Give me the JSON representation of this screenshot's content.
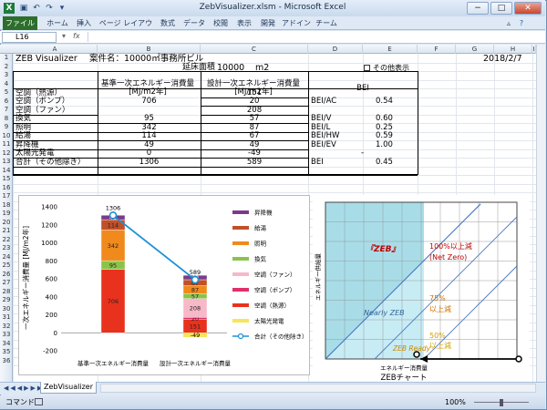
{
  "window": {
    "title": "ZebVisualizer.xlsm - Microsoft Excel",
    "controls": [
      "−",
      "□",
      "✕"
    ]
  },
  "ribbon": {
    "tabs": [
      "ファイル",
      "ホーム",
      "挿入",
      "ページ レイアウト",
      "数式",
      "データ",
      "校閲",
      "表示",
      "開発",
      "アドイン",
      "チーム"
    ]
  },
  "formula_bar": {
    "name_box": "L16",
    "fx": "fx",
    "content": ""
  },
  "columns": [
    "A",
    "B",
    "C",
    "D",
    "E",
    "F",
    "G",
    "H",
    "I"
  ],
  "rows": [
    "1",
    "2",
    "3",
    "4",
    "5",
    "6",
    "7",
    "8",
    "9",
    "10",
    "11",
    "12",
    "13",
    "14",
    "15",
    "16",
    "17",
    "18",
    "19",
    "20",
    "21",
    "22",
    "23",
    "24",
    "25",
    "26",
    "27",
    "28",
    "29",
    "30",
    "31",
    "32",
    "33",
    "34",
    "35",
    "36"
  ],
  "sheet": {
    "app_name": "ZEB Visualizer",
    "project": "案件名：10000㎡事務所ビル",
    "date": "2018/2/7",
    "floor_area_label": "延床面積",
    "floor_area_value": "10000",
    "floor_area_unit": "m2",
    "checkbox_label": "その他表示",
    "hdr_base": "基準一次エネルギー消費量",
    "hdr_base_unit": "[MJ/m2年]",
    "hdr_design": "設計一次エネルギー消費量",
    "hdr_design_unit": "[MJ/m2年]",
    "hdr_bei": "BEI",
    "rows": [
      {
        "label": "空調（熱源）",
        "base": "",
        "design": "151",
        "bei_label": "",
        "bei_value": ""
      },
      {
        "label": "空調（ポンプ）",
        "base": "706",
        "design": "20",
        "bei_label": "BEI/AC",
        "bei_value": "0.54"
      },
      {
        "label": "空調（ファン）",
        "base": "",
        "design": "208",
        "bei_label": "",
        "bei_value": ""
      },
      {
        "label": "換気",
        "base": "95",
        "design": "57",
        "bei_label": "BEI/V",
        "bei_value": "0.60"
      },
      {
        "label": "照明",
        "base": "342",
        "design": "87",
        "bei_label": "BEI/L",
        "bei_value": "0.25"
      },
      {
        "label": "給湯",
        "base": "114",
        "design": "67",
        "bei_label": "BEI/HW",
        "bei_value": "0.59"
      },
      {
        "label": "昇降機",
        "base": "49",
        "design": "49",
        "bei_label": "BEI/EV",
        "bei_value": "1.00"
      },
      {
        "label": "太陽光発電",
        "base": "0",
        "design": "-49",
        "bei_label": "",
        "bei_value": "-"
      },
      {
        "label": "合計（その他除き）",
        "base": "1306",
        "design": "589",
        "bei_label": "BEI",
        "bei_value": "0.45"
      }
    ]
  },
  "chart_data": [
    {
      "type": "bar",
      "categories": [
        "基準一次エネルギー消費量",
        "設計一次エネルギー消費量"
      ],
      "ylabel": "一次エネルギー消費量 [MJ/m2年]",
      "ylim": [
        -200,
        1400
      ],
      "yticks": [
        "1400",
        "1200",
        "1000",
        "800",
        "600",
        "400",
        "200",
        "0",
        "-200"
      ],
      "series": [
        {
          "name": "昇降機",
          "color": "#7a3b8c",
          "values": [
            49,
            49
          ]
        },
        {
          "name": "給湯",
          "color": "#c0502a",
          "values": [
            114,
            67
          ]
        },
        {
          "name": "照明",
          "color": "#f08a1c",
          "values": [
            342,
            87
          ]
        },
        {
          "name": "換気",
          "color": "#8bc34a",
          "values": [
            95,
            57
          ]
        },
        {
          "name": "空調（ファン）",
          "color": "#f7b8c8",
          "values": [
            0,
            208
          ]
        },
        {
          "name": "空調（ポンプ）",
          "color": "#e0306a",
          "values": [
            0,
            20
          ]
        },
        {
          "name": "空調（熱源）",
          "color": "#e8321e",
          "values": [
            706,
            151
          ]
        },
        {
          "name": "太陽光発電",
          "color": "#f5e65a",
          "values": [
            0,
            -49
          ]
        }
      ],
      "bar_labels": [
        [
          "49",
          "114",
          "342",
          "95",
          "",
          "",
          "706",
          ""
        ],
        [
          "49",
          "67",
          "87",
          "57",
          "208",
          "20",
          "151",
          "-49"
        ]
      ],
      "line": {
        "name": "合計（その他除き）",
        "color": "#1e90d6",
        "values": [
          1306,
          589
        ]
      },
      "total_labels": [
        "1306",
        "589"
      ],
      "legend_position": "right"
    },
    {
      "type": "diagram",
      "title": "ZEBチャート",
      "xlabel": "エネルギー消費量",
      "ylabel": "エネルギー供給量",
      "regions": [
        "『ZEB』",
        "Nearly ZEB",
        "ZEB Ready"
      ],
      "reduction_labels": [
        "100%以上減",
        "(Net Zero)",
        "75%",
        "以上減",
        "50%",
        "以上減"
      ]
    }
  ],
  "sheet_tabs": [
    "ZebVisualizer"
  ],
  "status": {
    "mode": "コマンド",
    "zoom": "100%"
  }
}
